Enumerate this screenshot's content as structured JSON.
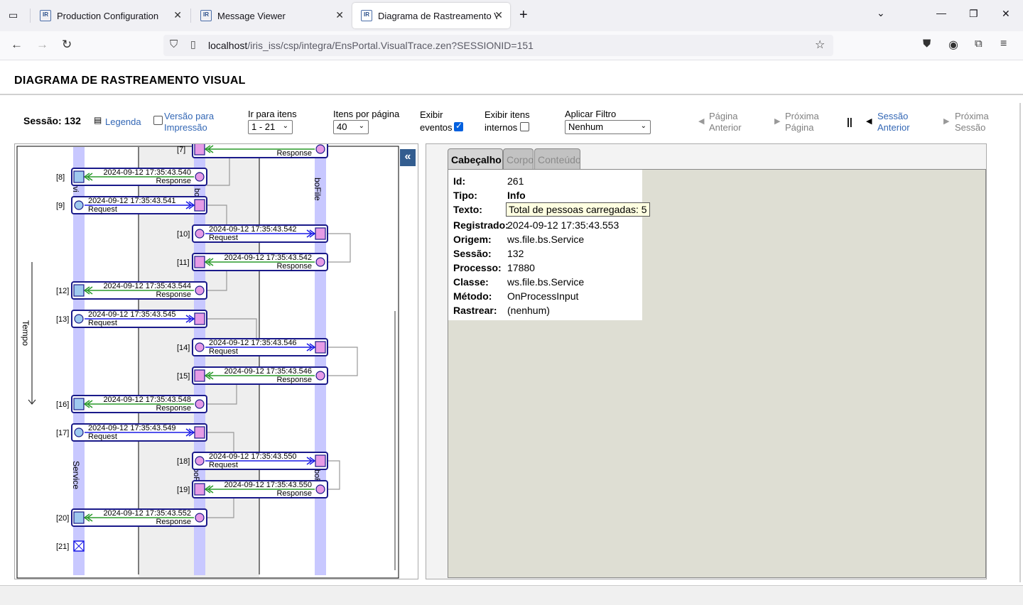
{
  "browser": {
    "tabs": [
      {
        "label": "Production Configuration",
        "icon": "iris-icon"
      },
      {
        "label": "Message Viewer",
        "icon": "iris-icon"
      },
      {
        "label": "Diagrama de Rastreamento Visu",
        "icon": "iris-icon"
      }
    ],
    "icon_text": "IR",
    "url_host": "localhost",
    "url_path": "/iris_iss/csp/integra/EnsPortal.VisualTrace.zen?SESSIONID=151"
  },
  "page": {
    "title": "DIAGRAMA DE RASTREAMENTO VISUAL"
  },
  "toolbar": {
    "session_label": "Sessão: 132",
    "legend": "Legenda",
    "print_line1": "Versão para",
    "print_line2": "Impressão",
    "goto_label": "Ir para itens",
    "goto_value": "1 - 21",
    "perpage_label": "Itens por página",
    "perpage_value": "40",
    "events_line1": "Exibir",
    "events_line2": "eventos",
    "internal_line1": "Exibir itens",
    "internal_line2": "internos",
    "filter_label": "Aplicar Filtro",
    "filter_value": "Nenhum",
    "prev_page_1": "Página",
    "prev_page_2": "Anterior",
    "next_page_1": "Próxima",
    "next_page_2": "Página",
    "pause": "||",
    "prev_session_1": "Sessão",
    "prev_session_2": "Anterior",
    "next_session_1": "Próxima",
    "next_session_2": "Sessão"
  },
  "diagram": {
    "time_label": "Tempo",
    "lane_labels": [
      "Service",
      "boFile",
      "boFile",
      "boFile",
      "boFi",
      "rvi"
    ],
    "messages": [
      {
        "index": "[7]",
        "ts": "",
        "type": "Response"
      },
      {
        "index": "[8]",
        "ts": "2024-09-12 17:35:43.540",
        "type": "Response"
      },
      {
        "index": "[9]",
        "ts": "2024-09-12 17:35:43.541",
        "type": "Request"
      },
      {
        "index": "[10]",
        "ts": "2024-09-12 17:35:43.542",
        "type": "Request"
      },
      {
        "index": "[11]",
        "ts": "2024-09-12 17:35:43.542",
        "type": "Response"
      },
      {
        "index": "[12]",
        "ts": "2024-09-12 17:35:43.544",
        "type": "Response"
      },
      {
        "index": "[13]",
        "ts": "2024-09-12 17:35:43.545",
        "type": "Request"
      },
      {
        "index": "[14]",
        "ts": "2024-09-12 17:35:43.546",
        "type": "Request"
      },
      {
        "index": "[15]",
        "ts": "2024-09-12 17:35:43.546",
        "type": "Response"
      },
      {
        "index": "[16]",
        "ts": "2024-09-12 17:35:43.548",
        "type": "Response"
      },
      {
        "index": "[17]",
        "ts": "2024-09-12 17:35:43.549",
        "type": "Request"
      },
      {
        "index": "[18]",
        "ts": "2024-09-12 17:35:43.550",
        "type": "Request"
      },
      {
        "index": "[19]",
        "ts": "2024-09-12 17:35:43.550",
        "type": "Response"
      },
      {
        "index": "[20]",
        "ts": "2024-09-12 17:35:43.552",
        "type": "Response"
      },
      {
        "index": "[21]",
        "ts": "",
        "type": ""
      }
    ]
  },
  "detail": {
    "tabs": [
      "Cabeçalho",
      "Corpo",
      "Conteúdo"
    ],
    "fields": [
      {
        "label": "Id:",
        "value": "261"
      },
      {
        "label": "Tipo:",
        "value": "Info"
      },
      {
        "label": "Texto:",
        "value": "Total de pessoas carregadas: 5"
      },
      {
        "label": "Registrado:",
        "value": "2024-09-12 17:35:43.553"
      },
      {
        "label": "Origem:",
        "value": "ws.file.bs.Service"
      },
      {
        "label": "Sessão:",
        "value": "132"
      },
      {
        "label": "Processo:",
        "value": "17880"
      },
      {
        "label": "Classe:",
        "value": "ws.file.bs.Service"
      },
      {
        "label": "Método:",
        "value": "OnProcessInput"
      },
      {
        "label": "Rastrear:",
        "value": "(nenhum)"
      }
    ]
  },
  "colors": {
    "lane": "#c8c8ff",
    "request_arrow": "#1a1ae6",
    "response_arrow": "#2a9a2a",
    "service_box": "#9fc9ef",
    "operation_box": "#e69be6",
    "link": "#3367b5"
  }
}
